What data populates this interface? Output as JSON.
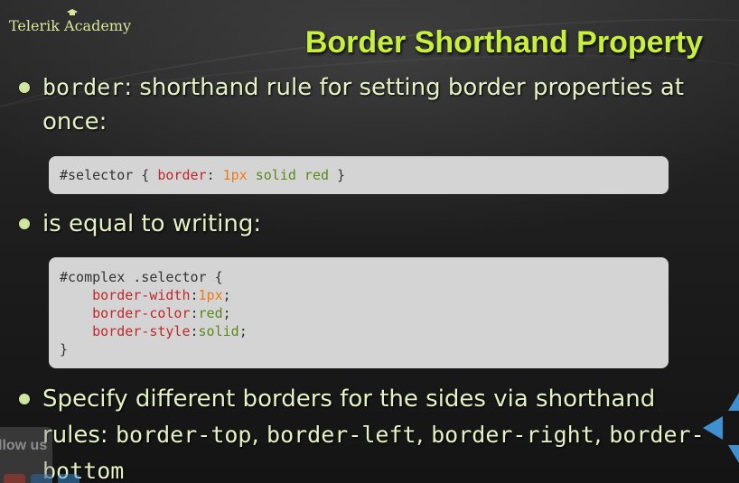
{
  "logo": {
    "text": "Telerik Academy"
  },
  "title": "Border Shorthand Property",
  "bullets": [
    {
      "code": "border",
      "text": ": shorthand rule for setting border properties at once:"
    },
    {
      "text": "is equal to writing:"
    },
    {
      "text_before": "Specify different borders for the sides via shorthand rules: ",
      "code1": "border-top",
      "sep1": ", ",
      "code2": "border-left",
      "sep2": ", ",
      "code3": "border-right",
      "sep3": ",",
      "code4": "border-bottom"
    }
  ],
  "code_block_1": {
    "selector": "#selector { ",
    "prop": "border",
    "colon": ": ",
    "value_num": "1px",
    "value_rest": " solid red",
    "close": " }"
  },
  "code_block_2": {
    "line1": "#complex .selector {",
    "rows": [
      {
        "prop": "border-width",
        "value": "1px",
        "value_kind": "number"
      },
      {
        "prop": "border-color",
        "value": "red",
        "value_kind": "keyword"
      },
      {
        "prop": "border-style",
        "value": "solid",
        "value_kind": "keyword"
      }
    ],
    "close": "}"
  },
  "follow": {
    "label": "llow us"
  },
  "navigation": {
    "prev_icon": "triangle-left-icon",
    "up_icon": "triangle-up-icon",
    "down_icon": "triangle-down-icon"
  },
  "colors": {
    "title": "#c8f03a",
    "body_text": "#e4f2c4",
    "code_background": "#d4d4d4",
    "code_property": "#c0282b",
    "code_number": "#ee7a17",
    "code_keyword": "#5b8a1a",
    "nav_arrow": "#3f8fd1"
  }
}
